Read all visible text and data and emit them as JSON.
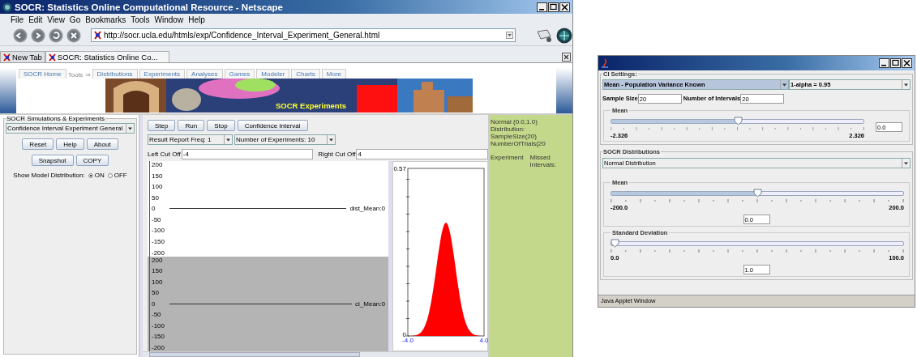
{
  "browser": {
    "title": "SOCR: Statistics Online Computational Resource - Netscape",
    "menu": [
      "File",
      "Edit",
      "View",
      "Go",
      "Bookmarks",
      "Tools",
      "Window",
      "Help"
    ],
    "url": "http://socr.ucla.edu/htmls/exp/Confidence_Interval_Experiment_General.html",
    "tabs": [
      {
        "label": "New Tab",
        "selected": false
      },
      {
        "label": "SOCR: Statistics Online Co...",
        "selected": true
      }
    ]
  },
  "site_nav": [
    {
      "label": "SOCR Home",
      "kind": "tab"
    },
    {
      "label": "Tools ⇒",
      "kind": "text"
    },
    {
      "label": "Distributions",
      "kind": "tab"
    },
    {
      "label": "Experiments",
      "kind": "tab"
    },
    {
      "label": "Analyses",
      "kind": "tab"
    },
    {
      "label": "Games",
      "kind": "tab"
    },
    {
      "label": "Modeler",
      "kind": "tab"
    },
    {
      "label": "Charts",
      "kind": "tab"
    },
    {
      "label": "More",
      "kind": "tab"
    }
  ],
  "banner": {
    "caption": "SOCR Experiments"
  },
  "left_panel": {
    "title": "SOCR Simulations & Experiments",
    "experiment": "Confidence Interval Experiment General",
    "button_rows": [
      [
        "Reset",
        "Help",
        "About"
      ],
      [
        "Snapshot",
        "COPY"
      ]
    ],
    "model_label": "Show Model Distribution:",
    "model_options": [
      {
        "label": "ON",
        "selected": true
      },
      {
        "label": "OFF",
        "selected": false
      }
    ]
  },
  "toolbar": [
    "Step",
    "Run",
    "Stop",
    "Confidence Interval"
  ],
  "dropdowns": [
    "Result Report Freq: 1",
    "Number of Experiments: 10"
  ],
  "cutoffs": [
    {
      "label": "Left Cut Off",
      "value": "-4"
    },
    {
      "label": "Right Cut Off",
      "value": "4"
    }
  ],
  "plots": [
    {
      "ticks": [
        "200",
        "150",
        "100",
        "50",
        "0",
        "-50",
        "-100",
        "-150",
        "-200"
      ],
      "line_label": "dist_Mean:0",
      "shaded": false
    },
    {
      "ticks": [
        "200",
        "150",
        "100",
        "50",
        "0",
        "-50",
        "-100",
        "-150",
        "-200"
      ],
      "line_label": "ci_Mean:0",
      "shaded": true
    }
  ],
  "density": {
    "y_max": "0.57",
    "y_min": "0",
    "x_min": "-4.0",
    "x_max": "4.0"
  },
  "results": {
    "lines": [
      "Normal (0.0,1.0) Distribution:",
      "SampleSize(20) NumberOfTrials(20"
    ],
    "columns": [
      "Experiment",
      "Missed Intervals:"
    ]
  },
  "dialog": {
    "ci_title": "CI Settings:",
    "method": "Mean - Population Variance Known",
    "alpha": "1-alpha = 0.95",
    "fields": [
      {
        "label": "Sample Size",
        "value": "20"
      },
      {
        "label": "Number of Intervals",
        "value": "20"
      }
    ],
    "ci_sliders": [
      {
        "kind": "inline",
        "title": "Mean",
        "level": 0.5,
        "min": "-2.326",
        "max": "2.326",
        "value": "0.0"
      }
    ],
    "dist_title": "SOCR Distributions",
    "distribution": "Normal Distribution",
    "dist_sliders": [
      {
        "kind": "stacked",
        "title": "Mean",
        "level": 0.5,
        "min": "-200.0",
        "max": "200.0",
        "value": "0.0"
      },
      {
        "kind": "stacked",
        "title": "Standard Deviation",
        "level": 0.01,
        "min": "0.0",
        "max": "100.0",
        "value": "1.0"
      }
    ],
    "status": "Java Applet Window"
  }
}
